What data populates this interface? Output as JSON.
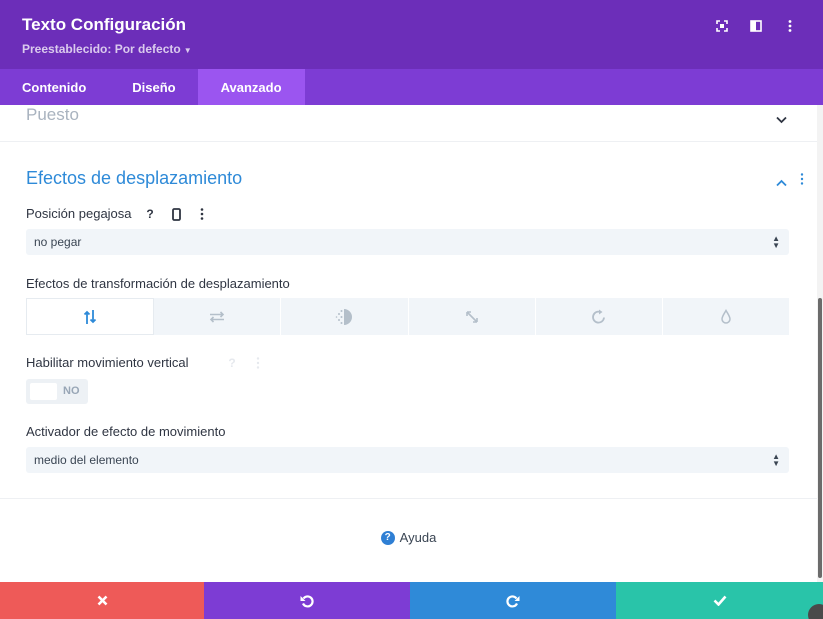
{
  "header": {
    "title": "Texto Configuración",
    "preset": "Preestablecido: Por defecto",
    "icons": [
      "fullscreen-icon",
      "split-view-icon",
      "more-options-icon"
    ],
    "bg_color": "#6c2eb9"
  },
  "tabs": [
    {
      "label": "Contenido"
    },
    {
      "label": "Diseño"
    },
    {
      "label": "Avanzado",
      "active": true
    }
  ],
  "sections": {
    "collapsed": {
      "title": "Puesto"
    },
    "scroll_effects": {
      "title": "Efectos de desplazamiento",
      "sticky": {
        "label": "Posición pegajosa",
        "value": "no pegar"
      },
      "transform": {
        "label": "Efectos de transformación de desplazamiento",
        "options": [
          "vertical-motion-icon",
          "horizontal-motion-icon",
          "fade-icon",
          "scale-icon",
          "rotate-icon",
          "blur-icon"
        ],
        "selected": 0
      },
      "vertical_motion": {
        "label": "Habilitar movimiento vertical",
        "toggle_text": "NO"
      },
      "trigger": {
        "label": "Activador de efecto de movimiento",
        "value": "medio del elemento"
      }
    }
  },
  "help": {
    "label": "Ayuda"
  },
  "footer": {
    "buttons": [
      {
        "name": "cancel-button",
        "color": "#ee5a58"
      },
      {
        "name": "undo-button",
        "color": "#7d3cd4"
      },
      {
        "name": "redo-button",
        "color": "#2f8ad8"
      },
      {
        "name": "save-button",
        "color": "#29c4a9"
      }
    ]
  },
  "colors": {
    "accent_blue": "#2e8ad8",
    "tab_active": "#9b55f0",
    "tab_bar": "#7d3cd4"
  }
}
